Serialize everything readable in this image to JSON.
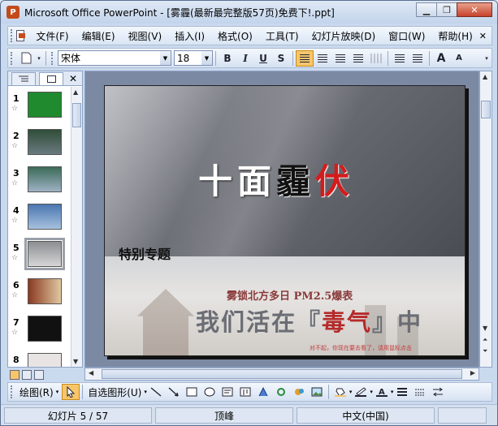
{
  "window": {
    "title": "Microsoft Office PowerPoint - [雾霾(最新最完整版57页)免费下!.ppt]",
    "icon_text": "P",
    "minimize": "▁",
    "restore": "❐",
    "close": "✕"
  },
  "menu": {
    "items": [
      "文件(F)",
      "编辑(E)",
      "视图(V)",
      "插入(I)",
      "格式(O)",
      "工具(T)",
      "幻灯片放映(D)",
      "窗口(W)",
      "帮助(H)"
    ],
    "close_doc": "✕"
  },
  "toolbar": {
    "font_name": "宋体",
    "font_size": "18",
    "bold": "B",
    "italic": "I",
    "underline": "U",
    "shadow": "S",
    "grow_font": "A",
    "shrink_font": "A"
  },
  "left_panel": {
    "tabs": [
      "outline-tab",
      "slides-tab"
    ],
    "close": "✕",
    "slides": [
      {
        "number": "1",
        "thumb_color": "#1f8a2e"
      },
      {
        "number": "2",
        "thumb_color": "#2f4d38"
      },
      {
        "number": "3",
        "thumb_color": "#3b6b58"
      },
      {
        "number": "4",
        "thumb_color": "#4a77b0"
      },
      {
        "number": "5",
        "thumb_color": "#8c8e93"
      },
      {
        "number": "6",
        "thumb_color": "#8a3a20"
      },
      {
        "number": "7",
        "thumb_color": "#111111"
      },
      {
        "number": "8",
        "thumb_color": "#e9e4e4"
      }
    ],
    "selected_index": 4,
    "star": "☆"
  },
  "slide": {
    "title_white": "十面",
    "title_black": "霾",
    "title_red": "伏",
    "subtitle": "特别专题",
    "headline": "雾锁北方多日 PM2.5爆表",
    "big_text_a": "我们活在『",
    "big_text_red": "毒气",
    "big_text_b": "』中",
    "small_note": "对不起，你现在要去看了，请用鼠标点击"
  },
  "drawbar": {
    "draw_label": "绘图(R)",
    "autoshapes_label": "自选图形(U)"
  },
  "status": {
    "slide_info": "幻灯片 5 / 57",
    "design": "顶峰",
    "language": "中文(中国)"
  },
  "colors": {
    "accent": "#f7c66b",
    "title_red": "#d31c1c"
  }
}
